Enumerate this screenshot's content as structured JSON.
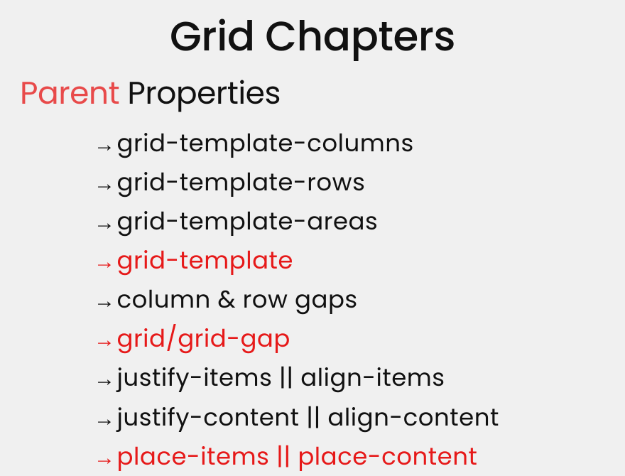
{
  "title": "Grid Chapters",
  "subtitle": {
    "highlight": "Parent",
    "rest": " Properties"
  },
  "arrow": "→",
  "items": [
    {
      "text": "grid-template-columns",
      "color": "black"
    },
    {
      "text": "grid-template-rows",
      "color": "black"
    },
    {
      "text": "grid-template-areas",
      "color": "black"
    },
    {
      "text": "grid-template",
      "color": "red"
    },
    {
      "text": "column & row gaps",
      "color": "black"
    },
    {
      "text": "grid/grid-gap",
      "color": "red"
    },
    {
      "text": "justify-items || align-items",
      "color": "black"
    },
    {
      "text": "justify-content || align-content",
      "color": "black"
    },
    {
      "text": "place-items || place-content",
      "color": "red"
    }
  ]
}
